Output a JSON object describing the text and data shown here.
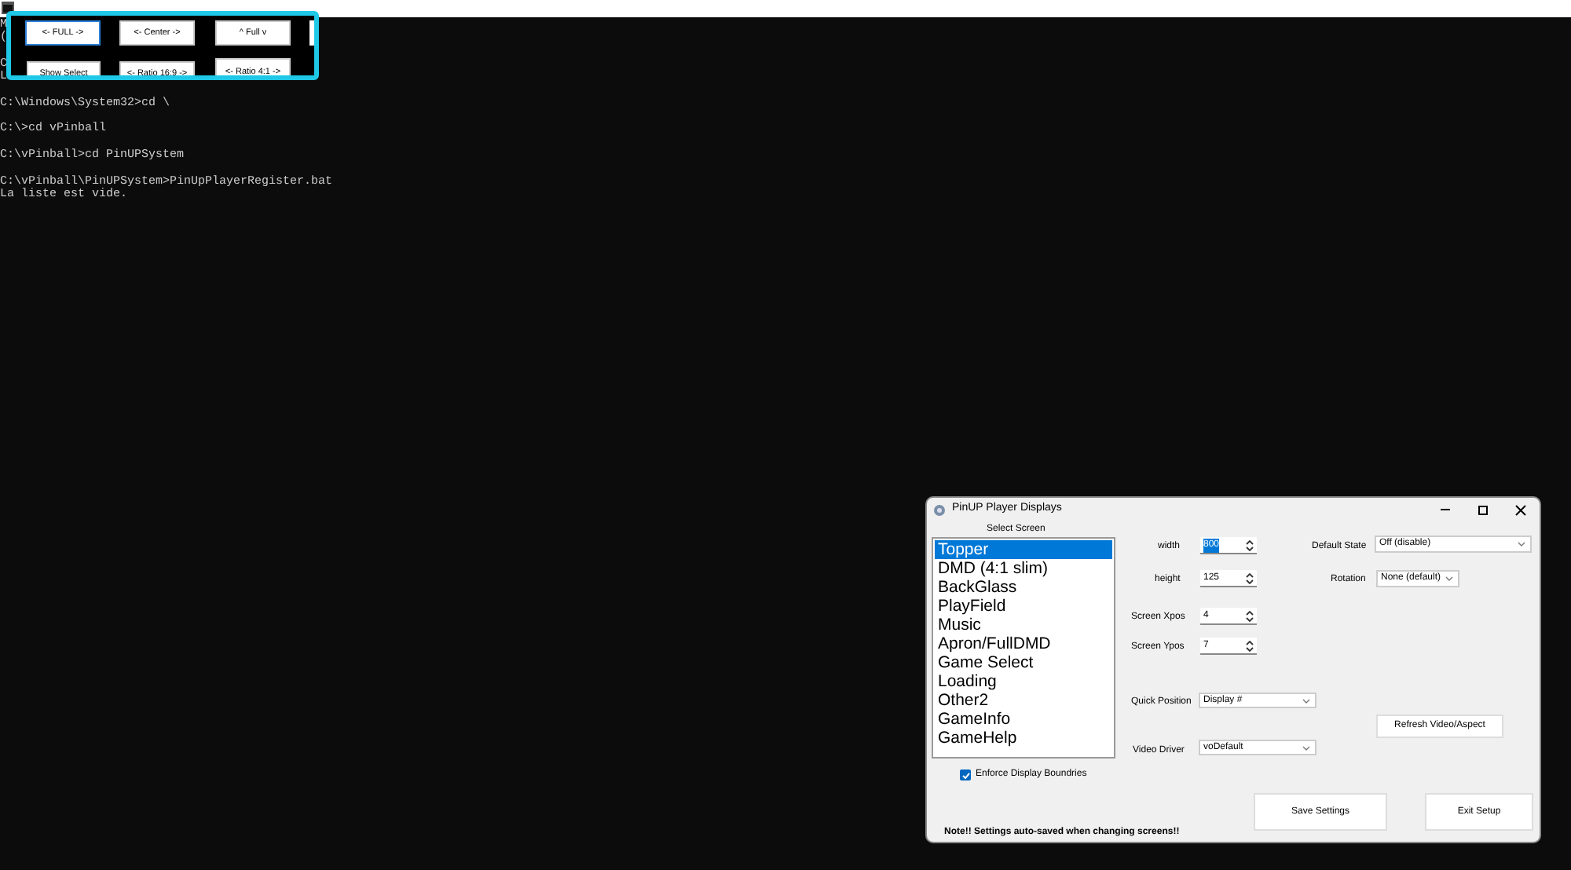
{
  "console": {
    "lines": [
      {
        "text": "M",
        "gap_before": false
      },
      {
        "text": "(",
        "gap_before": false
      },
      {
        "text": "C",
        "gap_before": true
      },
      {
        "text": "L",
        "gap_before": false
      },
      {
        "text": "C:\\Windows\\System32>cd \\",
        "gap_before": true
      },
      {
        "text": "C:\\>cd vPinball",
        "gap_before": true
      },
      {
        "text": "C:\\vPinball>cd PinUPSystem",
        "gap_before": true
      },
      {
        "text": "C:\\vPinball\\PinUPSystem>PinUpPlayerRegister.bat",
        "gap_before": true
      },
      {
        "text": "La liste est vide.",
        "gap_before": false
      }
    ]
  },
  "topper_window": {
    "buttons": [
      {
        "label": "<- FULL ->",
        "focused": true
      },
      {
        "label": "<- Center ->",
        "focused": false
      },
      {
        "label": "^  Full  v",
        "focused": false
      },
      {
        "label": "Show Select",
        "focused": false
      },
      {
        "label": "<- Ratio 16:9 ->",
        "focused": false
      },
      {
        "label": "<- Ratio 4:1 ->",
        "focused": false
      }
    ]
  },
  "dialog": {
    "title": "PinUP Player Displays",
    "select_label": "Select Screen",
    "screens": [
      {
        "label": "Topper",
        "selected": true
      },
      {
        "label": "DMD (4:1 slim)",
        "selected": false
      },
      {
        "label": "BackGlass",
        "selected": false
      },
      {
        "label": "PlayField",
        "selected": false
      },
      {
        "label": "Music",
        "selected": false
      },
      {
        "label": "Apron/FullDMD",
        "selected": false
      },
      {
        "label": "Game Select",
        "selected": false
      },
      {
        "label": "Loading",
        "selected": false
      },
      {
        "label": "Other2",
        "selected": false
      },
      {
        "label": "GameInfo",
        "selected": false
      },
      {
        "label": "GameHelp",
        "selected": false
      }
    ],
    "spinners": [
      {
        "label": "width",
        "value": "800"
      },
      {
        "label": "height",
        "value": "125"
      },
      {
        "label": "Screen Xpos",
        "value": "4"
      },
      {
        "label": "Screen Ypos",
        "value": "7"
      }
    ],
    "default_state": {
      "label": "Default State",
      "value": "Off (disable)"
    },
    "rotation": {
      "label": "Rotation",
      "value": "None (default)"
    },
    "quick_position": {
      "label": "Quick Position",
      "value": "Display #"
    },
    "video_driver": {
      "label": "Video Driver",
      "value": "voDefault"
    },
    "enforce": {
      "label": "Enforce Display Boundries",
      "checked": true
    },
    "buttons": {
      "refresh": "Refresh Video/Aspect",
      "save": "Save Settings",
      "exit": "Exit Setup"
    },
    "note": "Note!!  Settings auto-saved when changing screens!!"
  }
}
